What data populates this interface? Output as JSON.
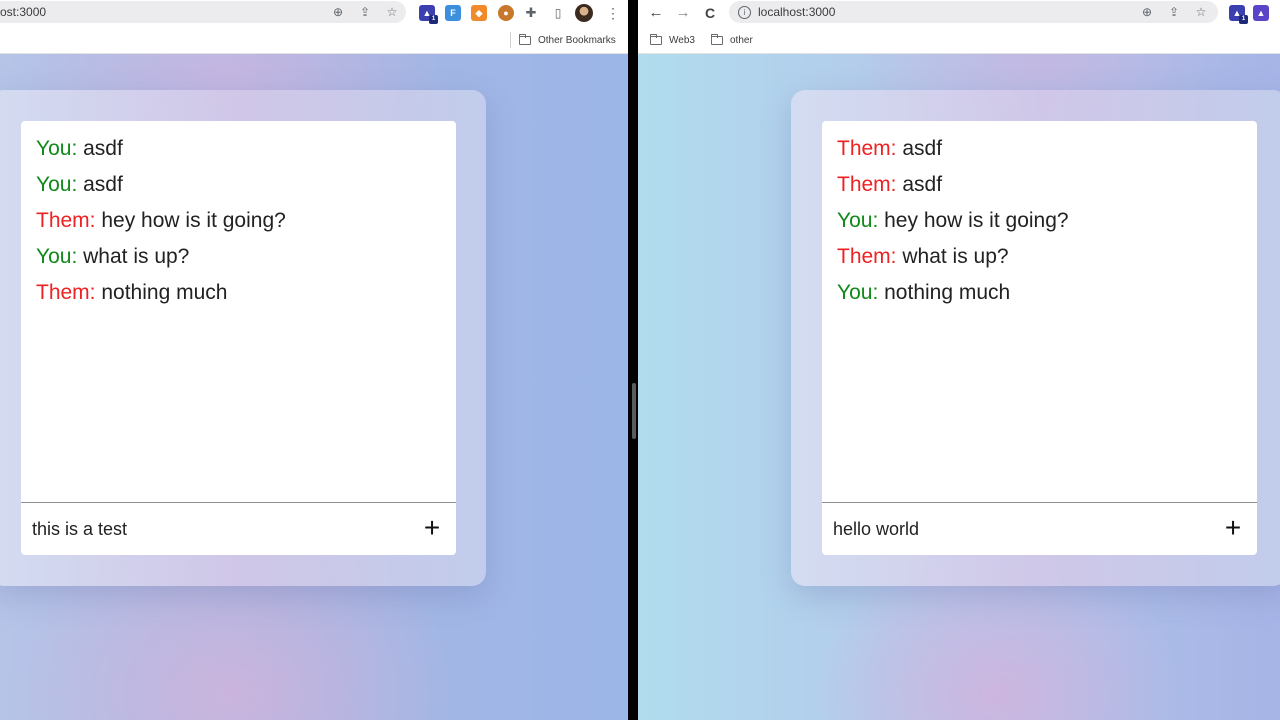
{
  "left_window": {
    "url": "ost:3000",
    "bookmarks": [
      {
        "label": "Other Bookmarks"
      }
    ],
    "chat": {
      "messages": [
        {
          "sender": "You:",
          "text": "asdf"
        },
        {
          "sender": "You:",
          "text": "asdf"
        },
        {
          "sender": "Them:",
          "text": "hey how is it going?"
        },
        {
          "sender": "You:",
          "text": "what is up?"
        },
        {
          "sender": "Them:",
          "text": "nothing much"
        }
      ],
      "input_value": "this is a test",
      "add_button_icon": "+"
    }
  },
  "right_window": {
    "url": "localhost:3000",
    "nav_icons": {
      "back": "←",
      "forward": "→",
      "reload": "C"
    },
    "bookmarks": [
      {
        "label": "Web3"
      },
      {
        "label": "other"
      }
    ],
    "chat": {
      "messages": [
        {
          "sender": "Them:",
          "text": "asdf"
        },
        {
          "sender": "Them:",
          "text": "asdf"
        },
        {
          "sender": "You:",
          "text": "hey how is it going?"
        },
        {
          "sender": "Them:",
          "text": "what is up?"
        },
        {
          "sender": "You:",
          "text": "nothing much"
        }
      ],
      "input_value": "hello world",
      "add_button_icon": "+"
    }
  },
  "colors": {
    "you": "#0f8a18",
    "them": "#ee2222"
  },
  "icons": {
    "zoom": "zoom-icon",
    "share": "share-icon",
    "bookmark_star": "star-icon",
    "extensions": [
      "graduation-cap-extension-icon",
      "f-extension-icon",
      "metamask-fox-icon",
      "bear-extension-icon",
      "puzzle-piece-icon",
      "side-panel-icon"
    ],
    "profile": "avatar",
    "menu": "kebab-menu-icon"
  }
}
